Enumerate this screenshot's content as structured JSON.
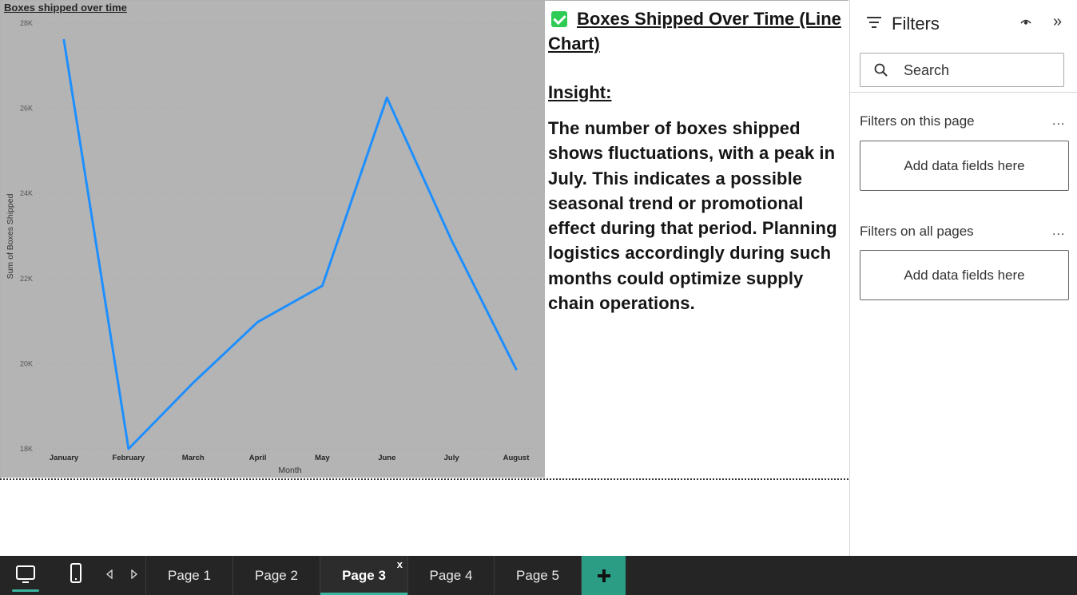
{
  "chart_data": {
    "type": "line",
    "title": "Boxes shipped over time",
    "xlabel": "Month",
    "ylabel": "Sum of Boxes Shipped",
    "categories": [
      "January",
      "February",
      "March",
      "April",
      "May",
      "June",
      "July",
      "August"
    ],
    "series": [
      {
        "values": [
          27600,
          18000,
          19550,
          20980,
          21830,
          26250,
          22900,
          19870
        ],
        "color": "#1e8fff"
      }
    ],
    "ylim": [
      18000,
      28000
    ],
    "yticks": [
      18000,
      20000,
      22000,
      24000,
      26000,
      28000
    ],
    "ytick_labels": [
      "18K",
      "20K",
      "22K",
      "24K",
      "26K",
      "28K"
    ],
    "grid": true,
    "background": "#b4b4b4"
  },
  "insight": {
    "heading": "Boxes Shipped Over Time (Line Chart)",
    "label": "Insight:",
    "body": "The number of boxes shipped shows fluctuations, with a peak in July. This indicates a possible seasonal trend or promotional effect during that period. Planning logistics accordingly during such months could optimize supply chain operations."
  },
  "filters": {
    "title": "Filters",
    "search_placeholder": "Search",
    "this_page_label": "Filters on this page",
    "all_pages_label": "Filters on all pages",
    "more_label": "...",
    "drop_label": "Add data fields here"
  },
  "pages": {
    "tabs": [
      "Page 1",
      "Page 2",
      "Page 3",
      "Page 4",
      "Page 5"
    ],
    "active": "Page 3",
    "close_label": "x"
  },
  "colors": {
    "accent": "#3bb5a0",
    "add_button": "#2a9d84",
    "line": "#1e8fff",
    "check": "#2ecc55"
  }
}
